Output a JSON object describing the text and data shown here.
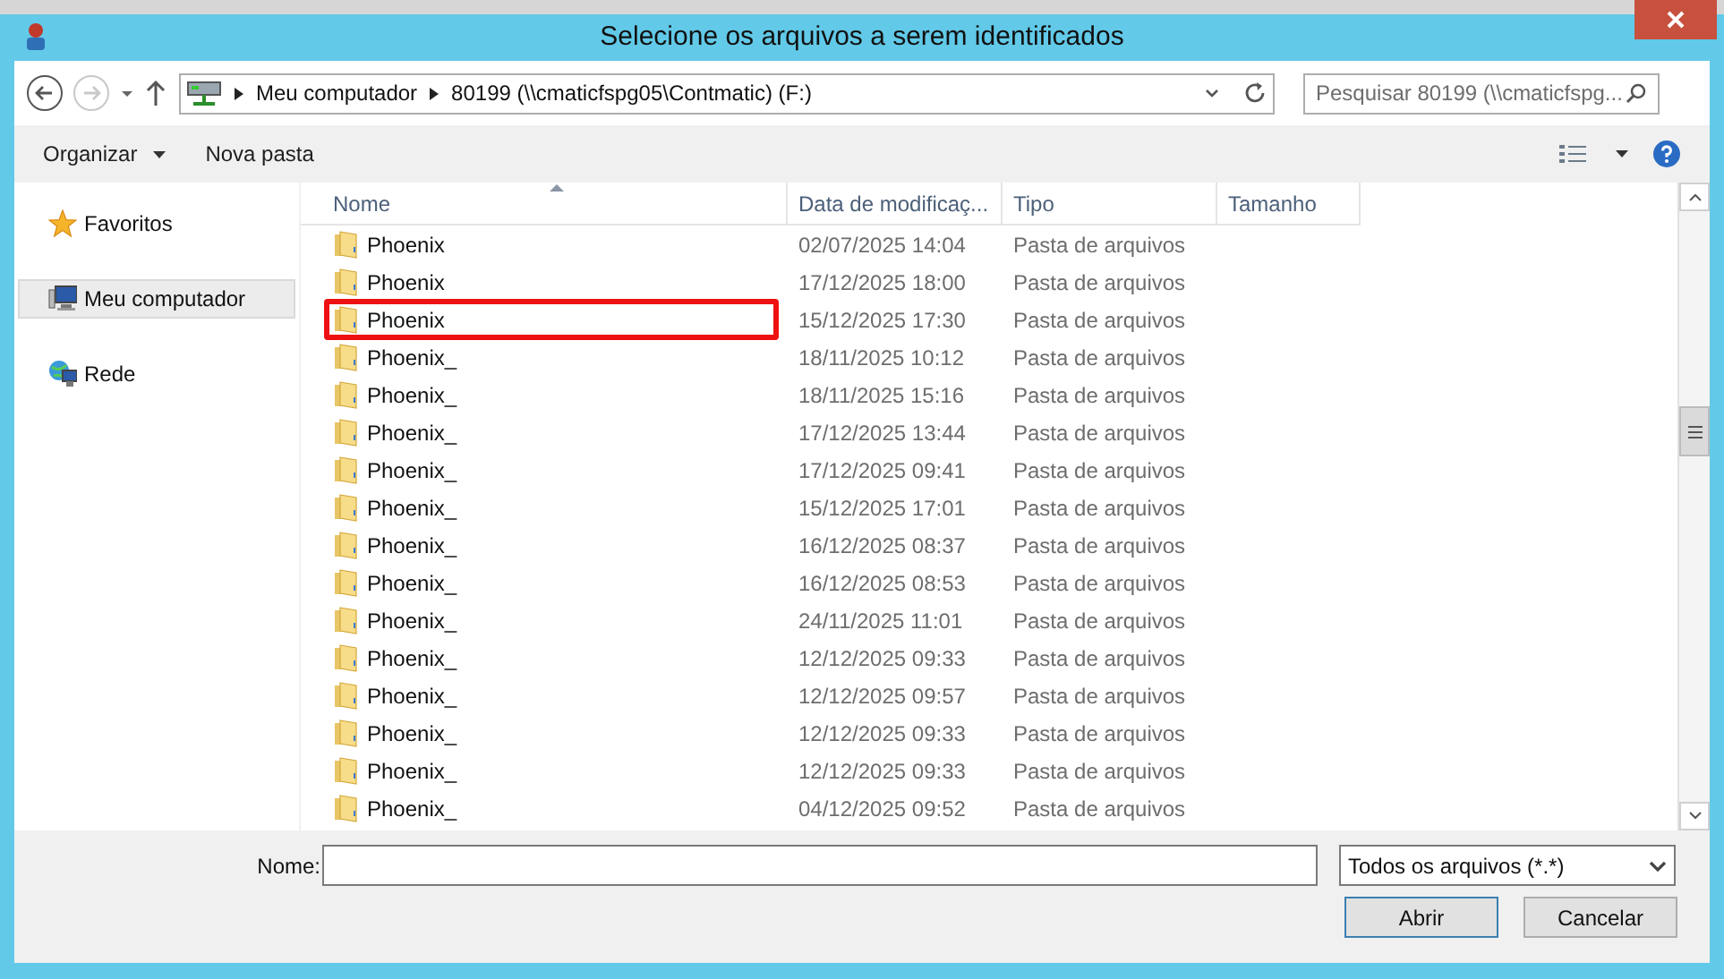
{
  "window": {
    "title": "Selecione os arquivos a serem identificados"
  },
  "address_bar": {
    "segments": [
      "Meu computador",
      "80199 (\\\\cmaticfspg05\\Contmatic) (F:)"
    ]
  },
  "search": {
    "placeholder": "Pesquisar 80199 (\\\\cmaticfspg..."
  },
  "toolbar": {
    "organize": "Organizar",
    "new_folder": "Nova pasta"
  },
  "sidebar": {
    "items": [
      {
        "label": "Favoritos",
        "kind": "favorites",
        "selected": false
      },
      {
        "label": "Meu computador",
        "kind": "computer",
        "selected": true
      },
      {
        "label": "Rede",
        "kind": "network",
        "selected": false
      }
    ]
  },
  "table": {
    "columns": [
      "Nome",
      "Data de modificaç...",
      "Tipo",
      "Tamanho"
    ],
    "rows": [
      {
        "name": "Phoenix",
        "date": "02/07/2025 14:04",
        "type": "Pasta de arquivos",
        "annotated": false
      },
      {
        "name": "Phoenix",
        "date": "17/12/2025 18:00",
        "type": "Pasta de arquivos",
        "annotated": false
      },
      {
        "name": "Phoenix",
        "date": "15/12/2025 17:30",
        "type": "Pasta de arquivos",
        "annotated": true
      },
      {
        "name": "Phoenix_",
        "date": "18/11/2025 10:12",
        "type": "Pasta de arquivos",
        "annotated": false
      },
      {
        "name": "Phoenix_",
        "date": "18/11/2025 15:16",
        "type": "Pasta de arquivos",
        "annotated": false
      },
      {
        "name": "Phoenix_",
        "date": "17/12/2025 13:44",
        "type": "Pasta de arquivos",
        "annotated": false
      },
      {
        "name": "Phoenix_",
        "date": "17/12/2025 09:41",
        "type": "Pasta de arquivos",
        "annotated": false
      },
      {
        "name": "Phoenix_",
        "date": "15/12/2025 17:01",
        "type": "Pasta de arquivos",
        "annotated": false
      },
      {
        "name": "Phoenix_",
        "date": "16/12/2025 08:37",
        "type": "Pasta de arquivos",
        "annotated": false
      },
      {
        "name": "Phoenix_",
        "date": "16/12/2025 08:53",
        "type": "Pasta de arquivos",
        "annotated": false
      },
      {
        "name": "Phoenix_",
        "date": "24/11/2025 11:01",
        "type": "Pasta de arquivos",
        "annotated": false
      },
      {
        "name": "Phoenix_",
        "date": "12/12/2025 09:33",
        "type": "Pasta de arquivos",
        "annotated": false
      },
      {
        "name": "Phoenix_",
        "date": "12/12/2025 09:57",
        "type": "Pasta de arquivos",
        "annotated": false
      },
      {
        "name": "Phoenix_",
        "date": "12/12/2025 09:33",
        "type": "Pasta de arquivos",
        "annotated": false
      },
      {
        "name": "Phoenix_",
        "date": "12/12/2025 09:33",
        "type": "Pasta de arquivos",
        "annotated": false
      },
      {
        "name": "Phoenix_",
        "date": "04/12/2025 09:52",
        "type": "Pasta de arquivos",
        "annotated": false
      }
    ]
  },
  "file_name": {
    "label": "Nome:"
  },
  "file_type": {
    "value": "Todos os arquivos (*.*)"
  },
  "buttons": [
    {
      "label": "Abrir",
      "kind": "default"
    },
    {
      "label": "Cancelar",
      "kind": "normal"
    }
  ]
}
